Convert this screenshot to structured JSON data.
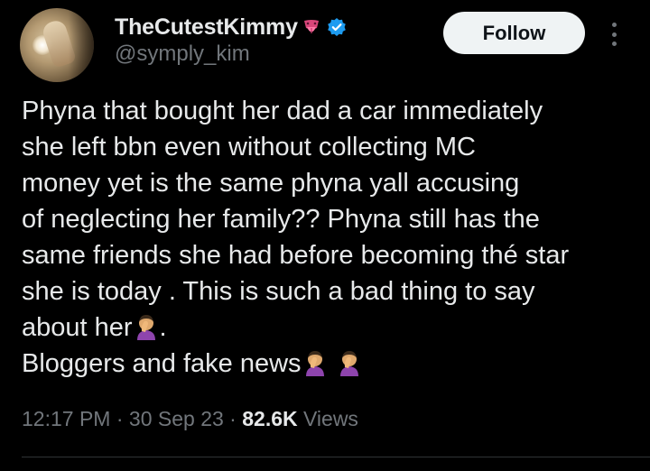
{
  "author": {
    "display_name": "TheCutestKimmy",
    "handle": "@symply_kim",
    "name_emoji": "tongue-emoji",
    "verified": true,
    "verified_color": "#1d9bf0"
  },
  "follow_button": {
    "label": "Follow"
  },
  "tweet": {
    "lines": [
      "Phyna that bought her dad a car immediately",
      "she left bbn even without collecting MC",
      "money yet is the same phyna yall accusing",
      "of neglecting her family?? Phyna still has the",
      "same friends  she had before becoming thé star",
      "she is today . This is such a bad thing to say",
      "about her",
      ".",
      "Bloggers and fake news"
    ],
    "emoji": "woman-facepalming-emoji"
  },
  "meta": {
    "time": "12:17 PM",
    "separator": "·",
    "date": "30 Sep 23",
    "views_count": "82.6K",
    "views_label": "Views"
  },
  "colors": {
    "background": "#000000",
    "text_primary": "#e7e9ea",
    "text_secondary": "#71767b",
    "button_bg": "#eff3f4",
    "divider": "#2f3336"
  }
}
